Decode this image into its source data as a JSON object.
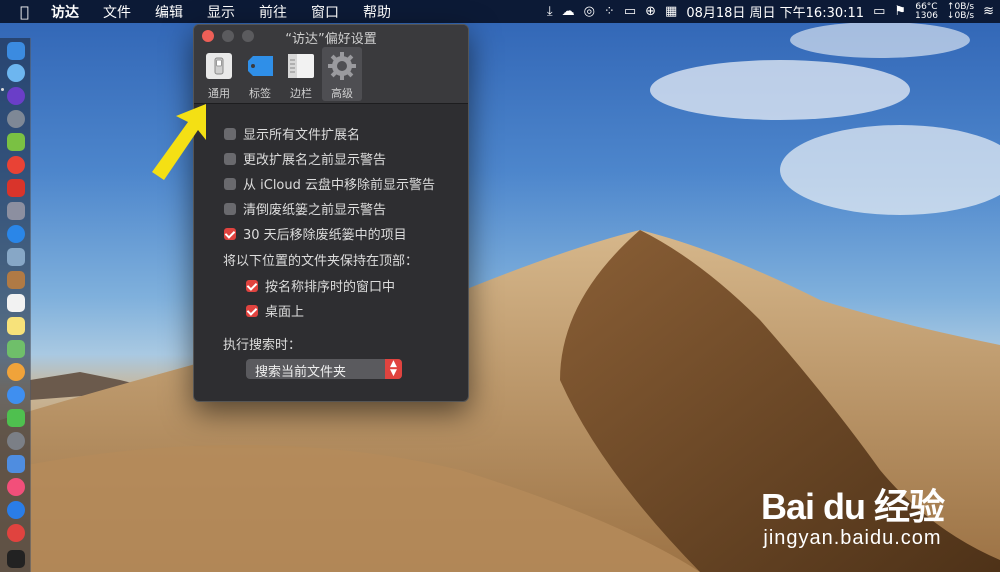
{
  "menubar": {
    "apple_icon": "apple-logo-icon",
    "menus": [
      "访达",
      "文件",
      "编辑",
      "显示",
      "前往",
      "窗口",
      "帮助"
    ],
    "status": {
      "datetime": "08月18日 周日 下午16:30:11",
      "temp": "66°C",
      "fan": "1306",
      "net_up": "↑0B/s",
      "net_down": "↓0B/s"
    }
  },
  "window": {
    "title": "“访达”偏好设置",
    "tabs": [
      {
        "label": "通用",
        "icon": "general-switch-icon"
      },
      {
        "label": "标签",
        "icon": "tag-icon"
      },
      {
        "label": "边栏",
        "icon": "sidebar-icon"
      },
      {
        "label": "高级",
        "icon": "gear-icon",
        "selected": true
      }
    ],
    "options": [
      {
        "label": "显示所有文件扩展名",
        "checked": false
      },
      {
        "label": "更改扩展名之前显示警告",
        "checked": false
      },
      {
        "label": "从 iCloud 云盘中移除前显示警告",
        "checked": false
      },
      {
        "label": "清倒废纸篓之前显示警告",
        "checked": false
      },
      {
        "label": "30 天后移除废纸篓中的项目",
        "checked": true
      }
    ],
    "folders_heading": "将以下位置的文件夹保持在顶部：",
    "folder_options": [
      {
        "label": "按名称排序时的窗口中",
        "checked": true
      },
      {
        "label": "桌面上",
        "checked": true
      }
    ],
    "search_heading": "执行搜索时：",
    "search_select": {
      "value": "搜索当前文件夹"
    }
  },
  "watermark": {
    "logo": "Bai du 经验",
    "url": "jingyan.baidu.com"
  },
  "colors": {
    "menubar": "#0c1a36",
    "window_bg": "#2e2e31",
    "accent": "#e0433f",
    "arrow": "#f4e014"
  }
}
